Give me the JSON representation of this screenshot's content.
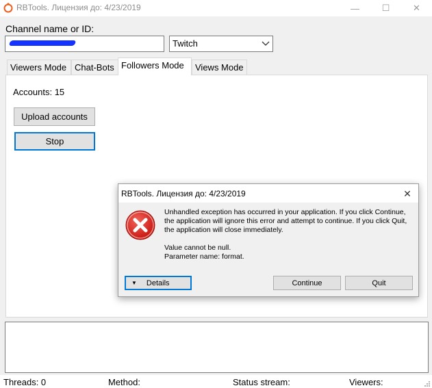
{
  "window": {
    "title": "RBTools. Лицензия до: 4/23/2019",
    "app_icon": "ring-logo-icon",
    "minimize_icon": "—",
    "maximize_icon": "☐",
    "close_icon": "✕"
  },
  "channel": {
    "label": "Channel name or ID:",
    "value_redacted": true,
    "platform": "Twitch"
  },
  "tabs": [
    {
      "label": "Viewers Mode",
      "active": false
    },
    {
      "label": "Chat-Bots",
      "active": false
    },
    {
      "label": "Followers Mode",
      "active": true
    },
    {
      "label": "Views Mode",
      "active": false
    }
  ],
  "followers": {
    "accounts_label": "Accounts: 15",
    "upload_label": "Upload accounts",
    "stop_label": "Stop"
  },
  "status": {
    "threads": "Threads: 0",
    "method": "Method:",
    "stream": "Status stream:",
    "viewers": "Viewers:"
  },
  "dialog": {
    "title": "RBTools. Лицензия до: 4/23/2019",
    "close_icon": "✕",
    "icon": "error-icon",
    "message": "Unhandled exception has occurred in your application. If you click Continue, the application will ignore this error and attempt to continue. If you click Quit, the application will close immediately.",
    "detail_line1": "Value cannot be null.",
    "detail_line2": "Parameter name: format.",
    "details_label": "Details",
    "continue_label": "Continue",
    "quit_label": "Quit"
  },
  "colors": {
    "accent": "#0078d7",
    "error_red": "#d9261c",
    "redaction_blue": "#1433ff"
  }
}
